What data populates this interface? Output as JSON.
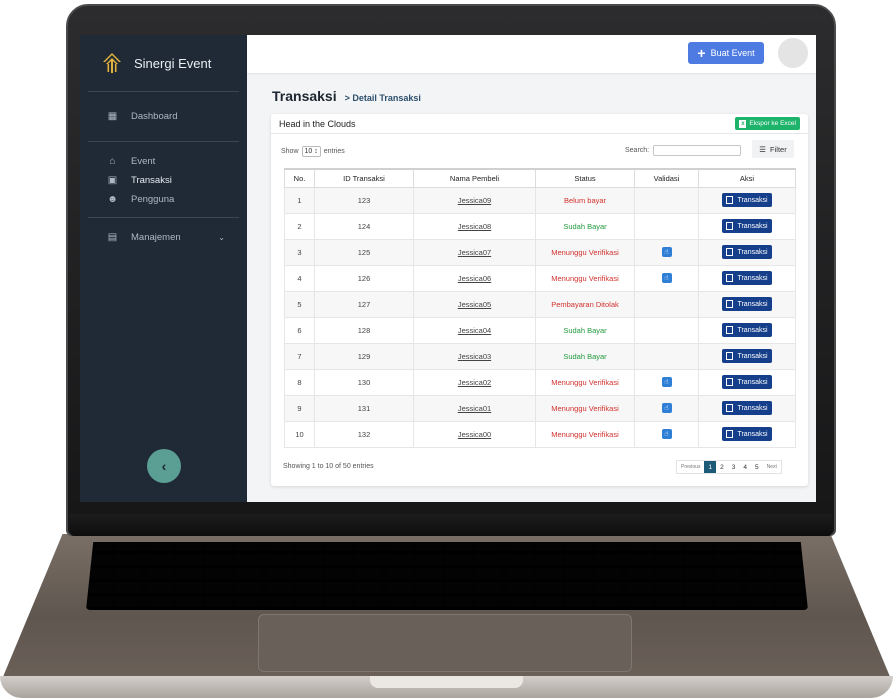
{
  "brand": {
    "name": "Sinergi Event"
  },
  "sidebar": {
    "items": [
      {
        "label": "Dashboard",
        "icon": "dashboard-icon"
      },
      {
        "label": "Event",
        "icon": "home-icon"
      },
      {
        "label": "Transaksi",
        "icon": "transaction-icon"
      },
      {
        "label": "Pengguna",
        "icon": "users-icon"
      },
      {
        "label": "Manajemen",
        "icon": "id-card-icon"
      }
    ]
  },
  "topbar": {
    "create_label": "Buat Event"
  },
  "breadcrumb": {
    "title": "Transaksi",
    "sub": "> Detail Transaksi"
  },
  "card": {
    "title": "Head in the Clouds",
    "export_label": "Ekspor ke Excel"
  },
  "controls": {
    "show_label": "Show",
    "show_value": "10 ↕",
    "entries_label": "entries",
    "search_label": "Search:",
    "filter_label": "Filter"
  },
  "table": {
    "headers": [
      "No.",
      "ID Transaksi",
      "Nama Pembeli",
      "Status",
      "Validasi",
      "Aksi"
    ],
    "action_label": "Transaksi",
    "rows": [
      {
        "no": "1",
        "id": "123",
        "buyer": "Jessica09",
        "status": "Belum bayar",
        "status_color": "#d0312d",
        "validate": false
      },
      {
        "no": "2",
        "id": "124",
        "buyer": "Jessica08",
        "status": "Sudah Bayar",
        "status_color": "#1f9a3c",
        "validate": false
      },
      {
        "no": "3",
        "id": "125",
        "buyer": "Jessica07",
        "status": "Menunggu Verifikasi",
        "status_color": "#d0312d",
        "validate": true
      },
      {
        "no": "4",
        "id": "126",
        "buyer": "Jessica06",
        "status": "Menunggu Verifikasi",
        "status_color": "#d0312d",
        "validate": true
      },
      {
        "no": "5",
        "id": "127",
        "buyer": "Jessica05",
        "status": "Pembayaran Ditolak",
        "status_color": "#d0312d",
        "validate": false
      },
      {
        "no": "6",
        "id": "128",
        "buyer": "Jessica04",
        "status": "Sudah Bayar",
        "status_color": "#1f9a3c",
        "validate": false
      },
      {
        "no": "7",
        "id": "129",
        "buyer": "Jessica03",
        "status": "Sudah Bayar",
        "status_color": "#1f9a3c",
        "validate": false
      },
      {
        "no": "8",
        "id": "130",
        "buyer": "Jessica02",
        "status": "Menunggu Verifikasi",
        "status_color": "#d0312d",
        "validate": true
      },
      {
        "no": "9",
        "id": "131",
        "buyer": "Jessica01",
        "status": "Menunggu Verifikasi",
        "status_color": "#d0312d",
        "validate": true
      },
      {
        "no": "10",
        "id": "132",
        "buyer": "Jessica00",
        "status": "Menunggu Verifikasi",
        "status_color": "#d0312d",
        "validate": true
      }
    ]
  },
  "footer": {
    "info": "Showing 1 to 10 of 50 entries",
    "previous": "Previous",
    "pages": [
      "1",
      "2",
      "3",
      "4",
      "5"
    ],
    "current_page": "1",
    "next": "Next"
  },
  "colors": {
    "sidebar": "#1f2a36",
    "accent": "#4e7be2",
    "action": "#153f8a",
    "excel": "#1db36a",
    "pager_active": "#1d5a77"
  }
}
